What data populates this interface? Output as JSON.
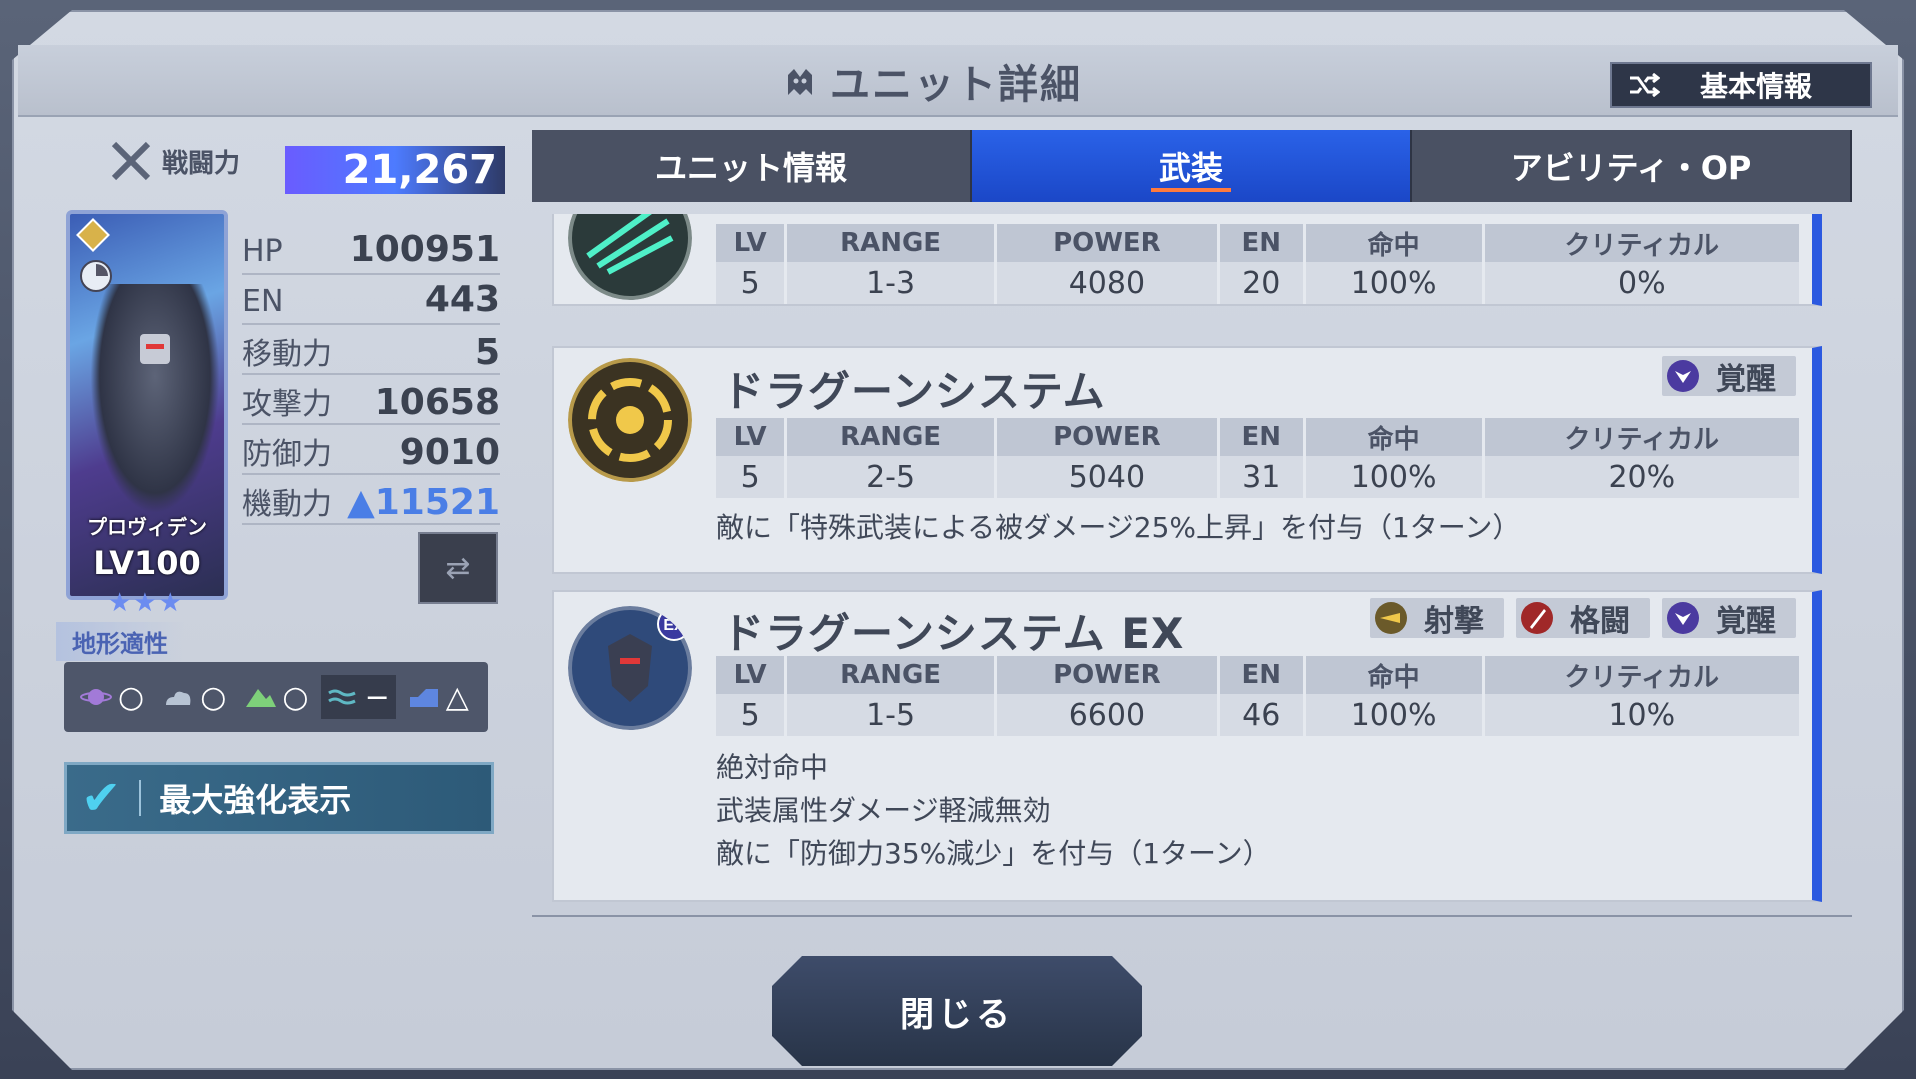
{
  "header": {
    "title": "ユニット詳細",
    "basic_info_label": "基本情報"
  },
  "power": {
    "label": "戦闘力",
    "value": "21,267"
  },
  "unit": {
    "name": "プロヴィデン",
    "level": "LV100",
    "stars": "★★★"
  },
  "stats": [
    {
      "label": "HP",
      "value": "100951"
    },
    {
      "label": "EN",
      "value": "443"
    },
    {
      "label": "移動力",
      "value": "5"
    },
    {
      "label": "攻撃力",
      "value": "10658"
    },
    {
      "label": "防御力",
      "value": "9010"
    },
    {
      "label": "機動力",
      "value": "11521"
    }
  ],
  "terrain": {
    "label": "地形適性",
    "ratings": [
      "○",
      "○",
      "○",
      "−",
      "△"
    ]
  },
  "max_enhance": {
    "label": "最大強化表示",
    "checked": true
  },
  "tabs": [
    {
      "label": "ユニット情報",
      "active": false
    },
    {
      "label": "武装",
      "active": true
    },
    {
      "label": "アビリティ・OP",
      "active": false
    }
  ],
  "table_headers": [
    "LV",
    "RANGE",
    "POWER",
    "EN",
    "命中",
    "クリティカル"
  ],
  "weapons": [
    {
      "name": "",
      "values": [
        "5",
        "1-3",
        "4080",
        "20",
        "100%",
        "0%"
      ],
      "tags": [],
      "desc": []
    },
    {
      "name": "ドラグーンシステム",
      "values": [
        "5",
        "2-5",
        "5040",
        "31",
        "100%",
        "20%"
      ],
      "tags": [
        "覚醒"
      ],
      "desc": [
        "敵に「特殊武装による被ダメージ25%上昇」を付与（1ターン）"
      ]
    },
    {
      "name": "ドラグーンシステム EX",
      "values": [
        "5",
        "1-5",
        "6600",
        "46",
        "100%",
        "10%"
      ],
      "tags": [
        "射撃",
        "格闘",
        "覚醒"
      ],
      "desc": [
        "絶対命中",
        "武装属性ダメージ軽減無効",
        "敵に「防御力35%減少」を付与（1ターン）"
      ]
    }
  ],
  "close_label": "閉じる",
  "colors": {
    "accent": "#2b59e0",
    "panel": "#e5e9ef",
    "bg": "#c6ccd8"
  }
}
